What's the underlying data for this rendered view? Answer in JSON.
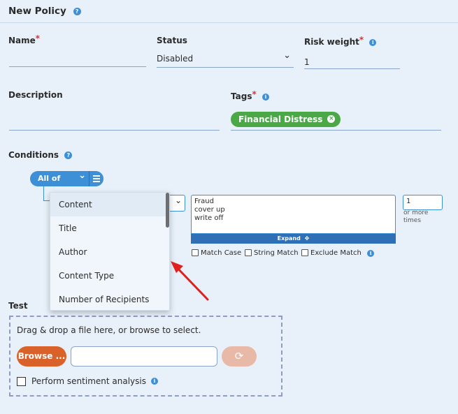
{
  "header": {
    "title": "New Policy",
    "help_icon": "question-circle-icon"
  },
  "form": {
    "name": {
      "label": "Name",
      "required": "*",
      "value": ""
    },
    "status": {
      "label": "Status",
      "value": "Disabled",
      "arrow": "⌄"
    },
    "risk_weight": {
      "label": "Risk weight",
      "required": "*",
      "value": "1"
    },
    "description": {
      "label": "Description",
      "value": ""
    },
    "tags": {
      "label": "Tags",
      "required": "*",
      "items": [
        {
          "label": "Financial Distress"
        }
      ]
    }
  },
  "conditions": {
    "label": "Conditions",
    "group_operator": "All of",
    "group_arrow": "⌄",
    "text_lines": [
      "Fraud",
      "cover up",
      "write off"
    ],
    "expand_label": "Expand",
    "times_value": "1",
    "times_label_1": "or more",
    "times_label_2": "times",
    "options": [
      {
        "label": "Match Case"
      },
      {
        "label": "String Match"
      },
      {
        "label": "Exclude Match"
      }
    ],
    "dropdown": {
      "items": [
        {
          "label": "Content"
        },
        {
          "label": "Title"
        },
        {
          "label": "Author"
        },
        {
          "label": "Content Type"
        },
        {
          "label": "Number of Recipients"
        }
      ],
      "active_index": 0
    }
  },
  "test": {
    "label": "Test",
    "dropzone_text": "Drag & drop a file here, or browse to select.",
    "browse_label": "Browse ...",
    "file_value": "",
    "sentiment_label": "Perform sentiment analysis"
  },
  "colors": {
    "accent": "#3d8fd6",
    "tag": "#4aa847",
    "browse": "#d9622b",
    "annotation_arrow": "#e0201c"
  }
}
